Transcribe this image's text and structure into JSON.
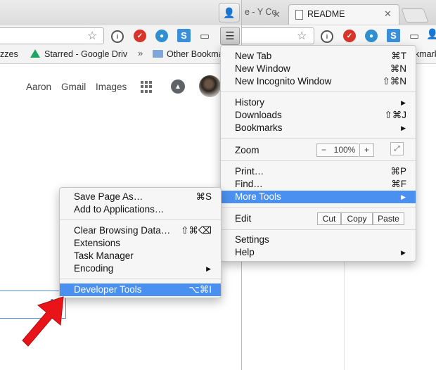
{
  "left_window": {
    "bookmarks": [
      "zzes",
      "Starred - Google Driv",
      "»",
      "Other Bookmar"
    ],
    "google_links": [
      "Aaron",
      "Gmail",
      "Images"
    ]
  },
  "right_window": {
    "tab_inactive": "e - Y Co",
    "tab_active": "README",
    "bookmark_text": "kmark"
  },
  "chrome_menu": {
    "new_tab": {
      "label": "New Tab",
      "shortcut": "⌘T"
    },
    "new_window": {
      "label": "New Window",
      "shortcut": "⌘N"
    },
    "new_incognito": {
      "label": "New Incognito Window",
      "shortcut": "⇧⌘N"
    },
    "history": {
      "label": "History"
    },
    "downloads": {
      "label": "Downloads",
      "shortcut": "⇧⌘J"
    },
    "bookmarks": {
      "label": "Bookmarks"
    },
    "zoom": {
      "label": "Zoom",
      "minus": "−",
      "value": "100%",
      "plus": "+"
    },
    "print": {
      "label": "Print…",
      "shortcut": "⌘P"
    },
    "find": {
      "label": "Find…",
      "shortcut": "⌘F"
    },
    "more_tools": {
      "label": "More Tools"
    },
    "edit": {
      "label": "Edit",
      "cut": "Cut",
      "copy": "Copy",
      "paste": "Paste"
    },
    "settings": {
      "label": "Settings"
    },
    "help": {
      "label": "Help"
    }
  },
  "more_tools_menu": {
    "save_page": {
      "label": "Save Page As…",
      "shortcut": "⌘S"
    },
    "add_to_apps": {
      "label": "Add to Applications…"
    },
    "clear_data": {
      "label": "Clear Browsing Data…",
      "shortcut": "⇧⌘⌫"
    },
    "extensions": {
      "label": "Extensions"
    },
    "task_manager": {
      "label": "Task Manager"
    },
    "encoding": {
      "label": "Encoding"
    },
    "developer_tools": {
      "label": "Developer Tools",
      "shortcut": "⌥⌘I"
    }
  },
  "colors": {
    "highlight": "#4a90f0",
    "arrow": "#e8141a"
  }
}
